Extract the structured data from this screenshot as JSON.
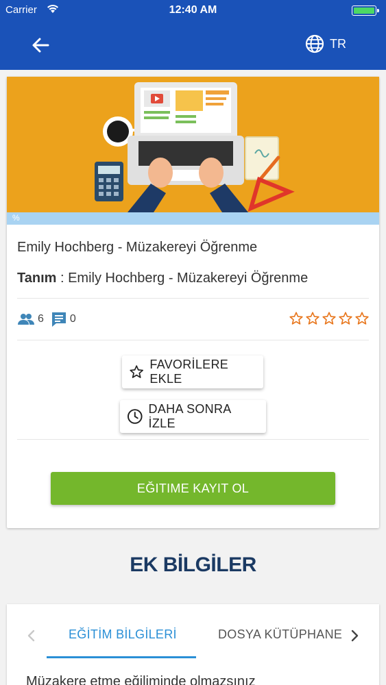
{
  "status_bar": {
    "carrier": "Carrier",
    "time": "12:40 AM"
  },
  "header": {
    "back_icon": "arrow-left-icon",
    "language_icon": "globe-icon",
    "language_code": "TR",
    "background_color": "#1a52b8"
  },
  "course": {
    "banner_badge": "%",
    "title": "Emily Hochberg - Müzakereyi Öğrenme",
    "description_label": "Tanım",
    "description_separator": " : ",
    "description_value": "Emily Hochberg - Müzakereyi Öğrenme",
    "participants_count": "6",
    "comments_count": "0",
    "rating_stars": 0,
    "rating_max": 5,
    "rating_color": "#e8761c"
  },
  "actions": {
    "favorite_label": "FAVORİLERE EKLE",
    "watch_later_label": "DAHA SONRA İZLE",
    "enroll_label": "EĞITIME KAYIT OL",
    "enroll_color": "#74b72c"
  },
  "additional_info": {
    "title": "EK BİLGİLER",
    "tabs": [
      {
        "label": "EĞİTİM BİLGİLERİ",
        "active": true
      },
      {
        "label": "DOSYA KÜTÜPHANE",
        "active": false
      }
    ],
    "content_preview": "Müzakere etme eğiliminde olmazsınız"
  }
}
